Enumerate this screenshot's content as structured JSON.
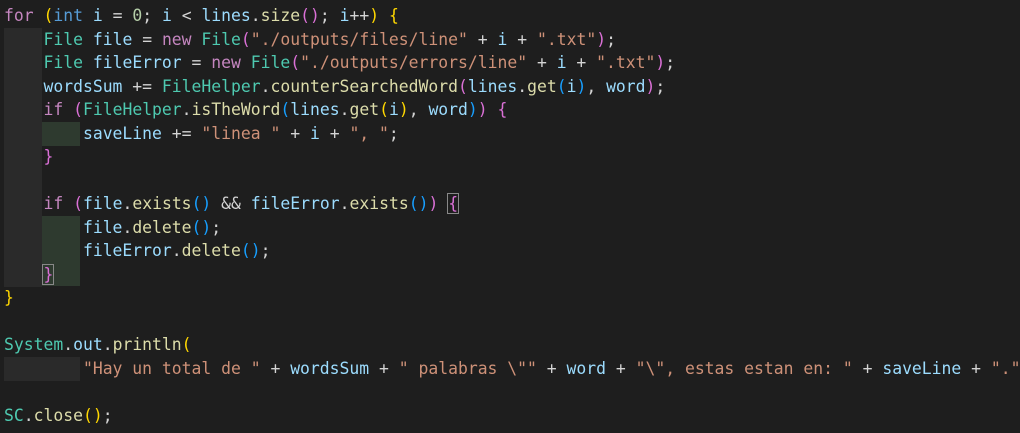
{
  "lines": [
    [
      [
        "k",
        "for"
      ],
      [
        "p",
        " "
      ],
      [
        "b1",
        "("
      ],
      [
        "t",
        "int"
      ],
      [
        "p",
        " "
      ],
      [
        "v",
        "i"
      ],
      [
        "p",
        " = "
      ],
      [
        "n",
        "0"
      ],
      [
        "p",
        "; "
      ],
      [
        "v",
        "i"
      ],
      [
        "p",
        " < "
      ],
      [
        "v",
        "lines"
      ],
      [
        "p",
        "."
      ],
      [
        "f",
        "size"
      ],
      [
        "b2",
        "()"
      ],
      [
        "p",
        "; "
      ],
      [
        "v",
        "i"
      ],
      [
        "p",
        "++"
      ],
      [
        "b1",
        ")"
      ],
      [
        "p",
        " "
      ],
      [
        "b1",
        "{"
      ]
    ],
    [
      [
        "p",
        "    "
      ],
      [
        "c",
        "File"
      ],
      [
        "p",
        " "
      ],
      [
        "v",
        "file"
      ],
      [
        "p",
        " = "
      ],
      [
        "k",
        "new"
      ],
      [
        "p",
        " "
      ],
      [
        "c",
        "File"
      ],
      [
        "b2",
        "("
      ],
      [
        "s",
        "\"./outputs/files/line\""
      ],
      [
        "p",
        " + "
      ],
      [
        "v",
        "i"
      ],
      [
        "p",
        " + "
      ],
      [
        "s",
        "\".txt\""
      ],
      [
        "b2",
        ")"
      ],
      [
        "p",
        ";"
      ]
    ],
    [
      [
        "p",
        "    "
      ],
      [
        "c",
        "File"
      ],
      [
        "p",
        " "
      ],
      [
        "v",
        "fileError"
      ],
      [
        "p",
        " = "
      ],
      [
        "k",
        "new"
      ],
      [
        "p",
        " "
      ],
      [
        "c",
        "File"
      ],
      [
        "b2",
        "("
      ],
      [
        "s",
        "\"./outputs/errors/line\""
      ],
      [
        "p",
        " + "
      ],
      [
        "v",
        "i"
      ],
      [
        "p",
        " + "
      ],
      [
        "s",
        "\".txt\""
      ],
      [
        "b2",
        ")"
      ],
      [
        "p",
        ";"
      ]
    ],
    [
      [
        "p",
        "    "
      ],
      [
        "v",
        "wordsSum"
      ],
      [
        "p",
        " += "
      ],
      [
        "c",
        "FileHelper"
      ],
      [
        "p",
        "."
      ],
      [
        "f",
        "counterSearchedWord"
      ],
      [
        "b2",
        "("
      ],
      [
        "v",
        "lines"
      ],
      [
        "p",
        "."
      ],
      [
        "f",
        "get"
      ],
      [
        "b3",
        "("
      ],
      [
        "v",
        "i"
      ],
      [
        "b3",
        ")"
      ],
      [
        "p",
        ", "
      ],
      [
        "v",
        "word"
      ],
      [
        "b2",
        ")"
      ],
      [
        "p",
        ";"
      ]
    ],
    [
      [
        "p",
        "    "
      ],
      [
        "k",
        "if"
      ],
      [
        "p",
        " "
      ],
      [
        "b2",
        "("
      ],
      [
        "c",
        "FileHelper"
      ],
      [
        "p",
        "."
      ],
      [
        "f",
        "isTheWord"
      ],
      [
        "b3",
        "("
      ],
      [
        "v",
        "lines"
      ],
      [
        "p",
        "."
      ],
      [
        "f",
        "get"
      ],
      [
        "b1",
        "("
      ],
      [
        "v",
        "i"
      ],
      [
        "b1",
        ")"
      ],
      [
        "p",
        ", "
      ],
      [
        "v",
        "word"
      ],
      [
        "b3",
        ")"
      ],
      [
        "b2",
        ")"
      ],
      [
        "p",
        " "
      ],
      [
        "b2",
        "{"
      ]
    ],
    [
      [
        "p",
        "        "
      ],
      [
        "v",
        "saveLine"
      ],
      [
        "p",
        " += "
      ],
      [
        "s",
        "\"linea \""
      ],
      [
        "p",
        " + "
      ],
      [
        "v",
        "i"
      ],
      [
        "p",
        " + "
      ],
      [
        "s",
        "\", \""
      ],
      [
        "p",
        ";"
      ]
    ],
    [
      [
        "p",
        "    "
      ],
      [
        "b2",
        "}"
      ]
    ],
    [],
    [
      [
        "p",
        "    "
      ],
      [
        "k",
        "if"
      ],
      [
        "p",
        " "
      ],
      [
        "b2",
        "("
      ],
      [
        "v",
        "file"
      ],
      [
        "p",
        "."
      ],
      [
        "f",
        "exists"
      ],
      [
        "b3",
        "()"
      ],
      [
        "p",
        " && "
      ],
      [
        "v",
        "fileError"
      ],
      [
        "p",
        "."
      ],
      [
        "f",
        "exists"
      ],
      [
        "b3",
        "()"
      ],
      [
        "b2",
        ")"
      ],
      [
        "p",
        " "
      ],
      [
        "b2",
        "{"
      ]
    ],
    [
      [
        "p",
        "        "
      ],
      [
        "v",
        "file"
      ],
      [
        "p",
        "."
      ],
      [
        "f",
        "delete"
      ],
      [
        "b3",
        "()"
      ],
      [
        "p",
        ";"
      ]
    ],
    [
      [
        "p",
        "        "
      ],
      [
        "v",
        "fileError"
      ],
      [
        "p",
        "."
      ],
      [
        "f",
        "delete"
      ],
      [
        "b3",
        "()"
      ],
      [
        "p",
        ";"
      ]
    ],
    [
      [
        "p",
        "    "
      ],
      [
        "b2",
        "}"
      ]
    ],
    [
      [
        "b1",
        "}"
      ]
    ],
    [],
    [
      [
        "c",
        "System"
      ],
      [
        "p",
        "."
      ],
      [
        "v",
        "out"
      ],
      [
        "p",
        "."
      ],
      [
        "f",
        "println"
      ],
      [
        "b1",
        "("
      ]
    ],
    [
      [
        "p",
        "        "
      ],
      [
        "s",
        "\"Hay un total de \""
      ],
      [
        "p",
        " + "
      ],
      [
        "v",
        "wordsSum"
      ],
      [
        "p",
        " + "
      ],
      [
        "s",
        "\" palabras \\\"\""
      ],
      [
        "p",
        " + "
      ],
      [
        "v",
        "word"
      ],
      [
        "p",
        " + "
      ],
      [
        "s",
        "\"\\\", estas estan en: \""
      ],
      [
        "p",
        " + "
      ],
      [
        "v",
        "saveLine"
      ],
      [
        "p",
        " + "
      ],
      [
        "s",
        "\".\""
      ],
      [
        "b1",
        ")"
      ],
      [
        "p",
        ";"
      ]
    ],
    [],
    [
      [
        "c",
        "SC"
      ],
      [
        "p",
        "."
      ],
      [
        "f",
        "close"
      ],
      [
        "b1",
        "()"
      ],
      [
        "p",
        ";"
      ]
    ]
  ]
}
